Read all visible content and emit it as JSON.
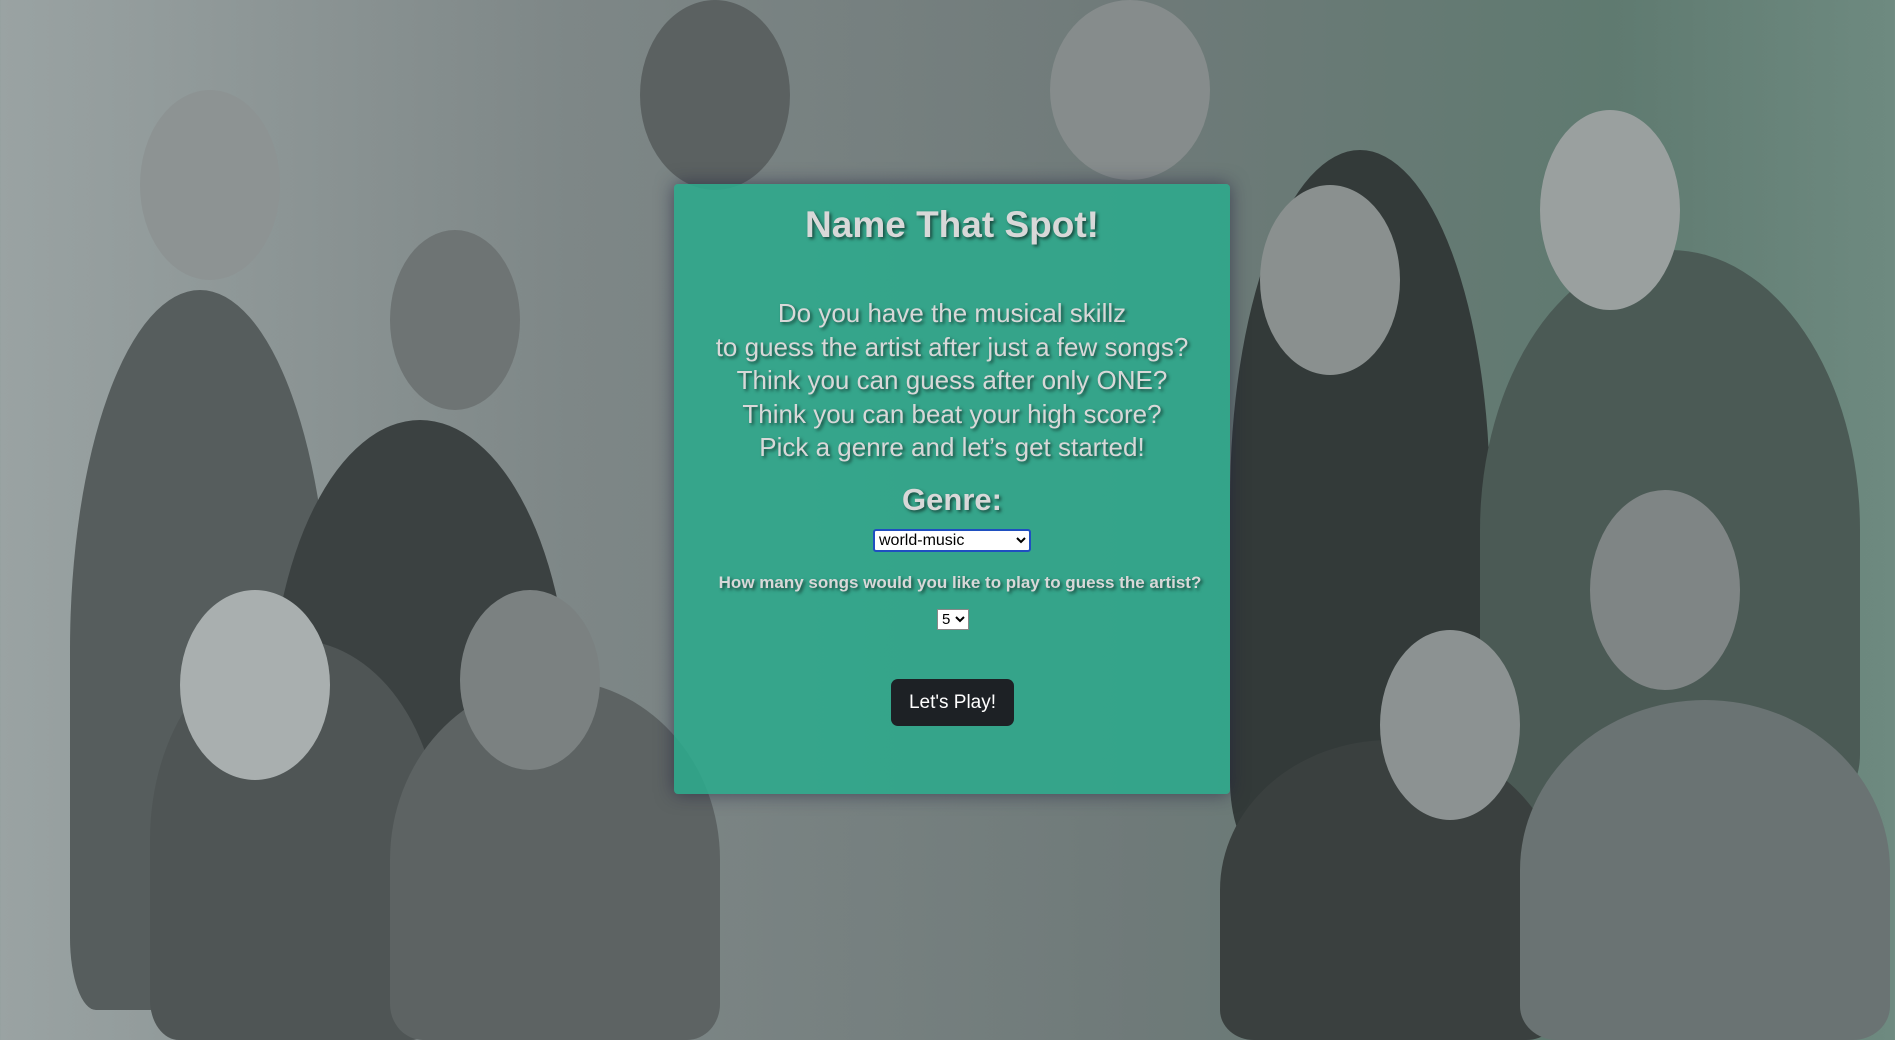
{
  "title": "Name That Spot!",
  "intro": [
    "Do you have the musical skillz",
    "to guess the artist after just a few songs?",
    "Think you can guess after only ONE?",
    "Think you can beat your high score?",
    "Pick a genre and let’s get started!"
  ],
  "genre_label": "Genre:",
  "genre_selected": "world-music",
  "songs_question": "How many songs would you like to play to guess the artist?",
  "songs_selected": "5",
  "play_button": "Let's Play!"
}
